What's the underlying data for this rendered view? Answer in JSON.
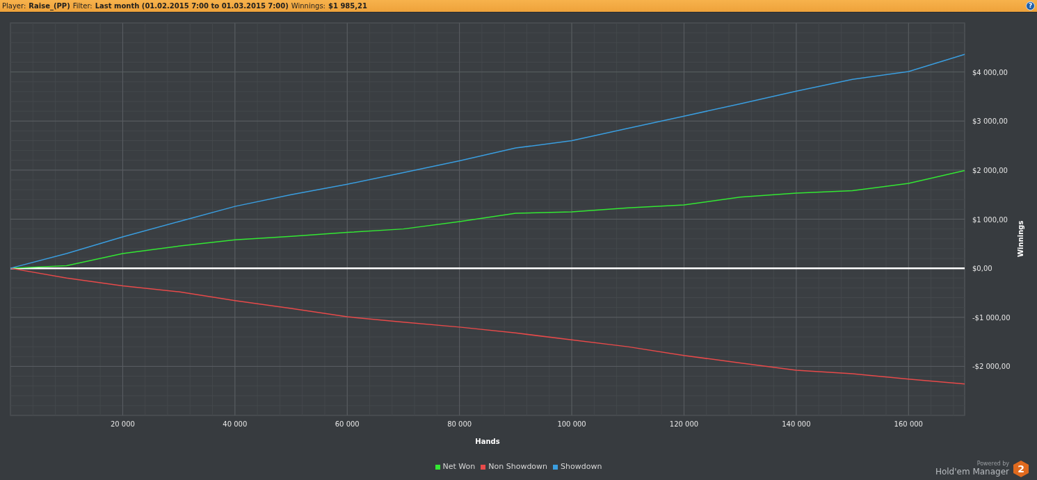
{
  "header": {
    "items": [
      {
        "label": "Player:",
        "value": "Raise_(PP)"
      },
      {
        "label": "Filter:",
        "value": "Last month (01.02.2015 7:00 to 01.03.2015 7:00)"
      },
      {
        "label": "Winnings:",
        "value": "$1 985,21"
      }
    ],
    "help_button": "?"
  },
  "chart": {
    "chart_data": {
      "type": "line",
      "grid": true,
      "xlabel": "Hands",
      "ylabel": "Winnings",
      "x": [
        0,
        10000,
        20000,
        30000,
        40000,
        50000,
        60000,
        70000,
        80000,
        90000,
        100000,
        110000,
        120000,
        130000,
        140000,
        150000,
        160000,
        170000
      ],
      "xlim": [
        0,
        170000
      ],
      "ylim": [
        -3000,
        5000
      ],
      "xticks": [
        {
          "value": 20000,
          "label": "20 000"
        },
        {
          "value": 40000,
          "label": "40 000"
        },
        {
          "value": 60000,
          "label": "60 000"
        },
        {
          "value": 80000,
          "label": "80 000"
        },
        {
          "value": 100000,
          "label": "100 000"
        },
        {
          "value": 120000,
          "label": "120 000"
        },
        {
          "value": 140000,
          "label": "140 000"
        },
        {
          "value": 160000,
          "label": "160 000"
        }
      ],
      "yticks": [
        {
          "value": -2000,
          "label": "-$2 000,00"
        },
        {
          "value": -1000,
          "label": "-$1 000,00"
        },
        {
          "value": 0,
          "label": "$0,00"
        },
        {
          "value": 1000,
          "label": "$1 000,00"
        },
        {
          "value": 2000,
          "label": "$2 000,00"
        },
        {
          "value": 3000,
          "label": "$3 000,00"
        },
        {
          "value": 4000,
          "label": "$4 000,00"
        }
      ],
      "series": [
        {
          "name": "Net Won",
          "color": "#33e833",
          "values": [
            0,
            50,
            300,
            450,
            580,
            650,
            730,
            800,
            950,
            1120,
            1150,
            1230,
            1290,
            1450,
            1530,
            1580,
            1730,
            1990
          ]
        },
        {
          "name": "Non Showdown",
          "color": "#e84a4a",
          "values": [
            0,
            -200,
            -360,
            -480,
            -660,
            -820,
            -990,
            -1100,
            -1200,
            -1320,
            -1460,
            -1600,
            -1780,
            -1930,
            -2080,
            -2150,
            -2260,
            -2360
          ]
        },
        {
          "name": "Showdown",
          "color": "#3a9ee0",
          "values": [
            0,
            300,
            640,
            950,
            1260,
            1500,
            1710,
            1950,
            2190,
            2450,
            2600,
            2850,
            3100,
            3350,
            3610,
            3850,
            4010,
            4360
          ]
        }
      ]
    }
  },
  "logo": {
    "caption": "Powered by",
    "name": "Hold'em Manager",
    "badge": "2"
  }
}
